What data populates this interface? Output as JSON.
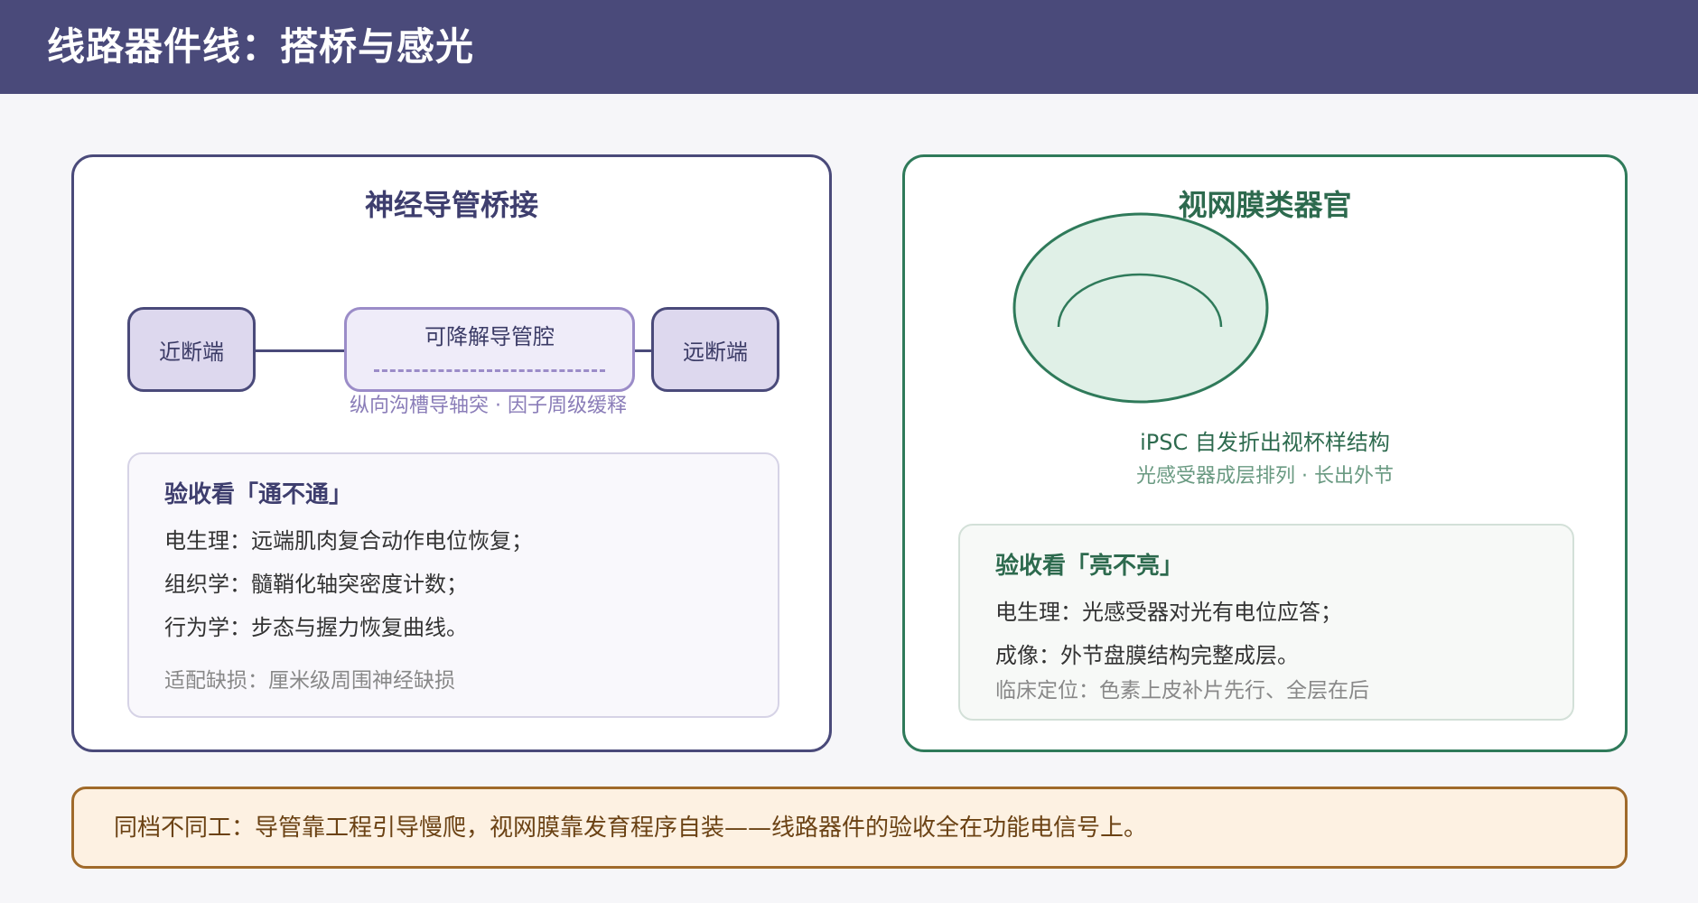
{
  "page_title": "线路器件线：搭桥与感光",
  "left_card": {
    "title": "神经导管桥接",
    "proximal_label": "近断端",
    "conduit_label": "可降解导管腔",
    "distal_label": "远断端",
    "conduit_caption": "纵向沟槽导轴突 · 因子周级缓释",
    "acceptance": {
      "title": "验收看「通不通」",
      "items": [
        "电生理：远端肌肉复合动作电位恢复；",
        "组织学：髓鞘化轴突密度计数；",
        "行为学：步态与握力恢复曲线。"
      ],
      "note": "适配缺损：厘米级周围神经缺损"
    }
  },
  "right_card": {
    "title": "视网膜类器官",
    "organoid_caption": "iPSC 自发折出视杯样结构",
    "organoid_subcaption": "光感受器成层排列 · 长出外节",
    "acceptance": {
      "title": "验收看「亮不亮」",
      "items": [
        "电生理：光感受器对光有电位应答；",
        "成像：外节盘膜结构完整成层。"
      ],
      "note": "临床定位：色素上皮补片先行、全层在后"
    }
  },
  "footer_text": "同档不同工：导管靠工程引导慢爬，视网膜靠发育程序自装——线路器件的验收全在功能电信号上。",
  "colors": {
    "header": "#4a4a7a",
    "left_accent": "#4a4a7a",
    "conduit_accent": "#9b8cc8",
    "right_accent": "#2f7a5a",
    "footer_accent": "#a06a2a"
  }
}
